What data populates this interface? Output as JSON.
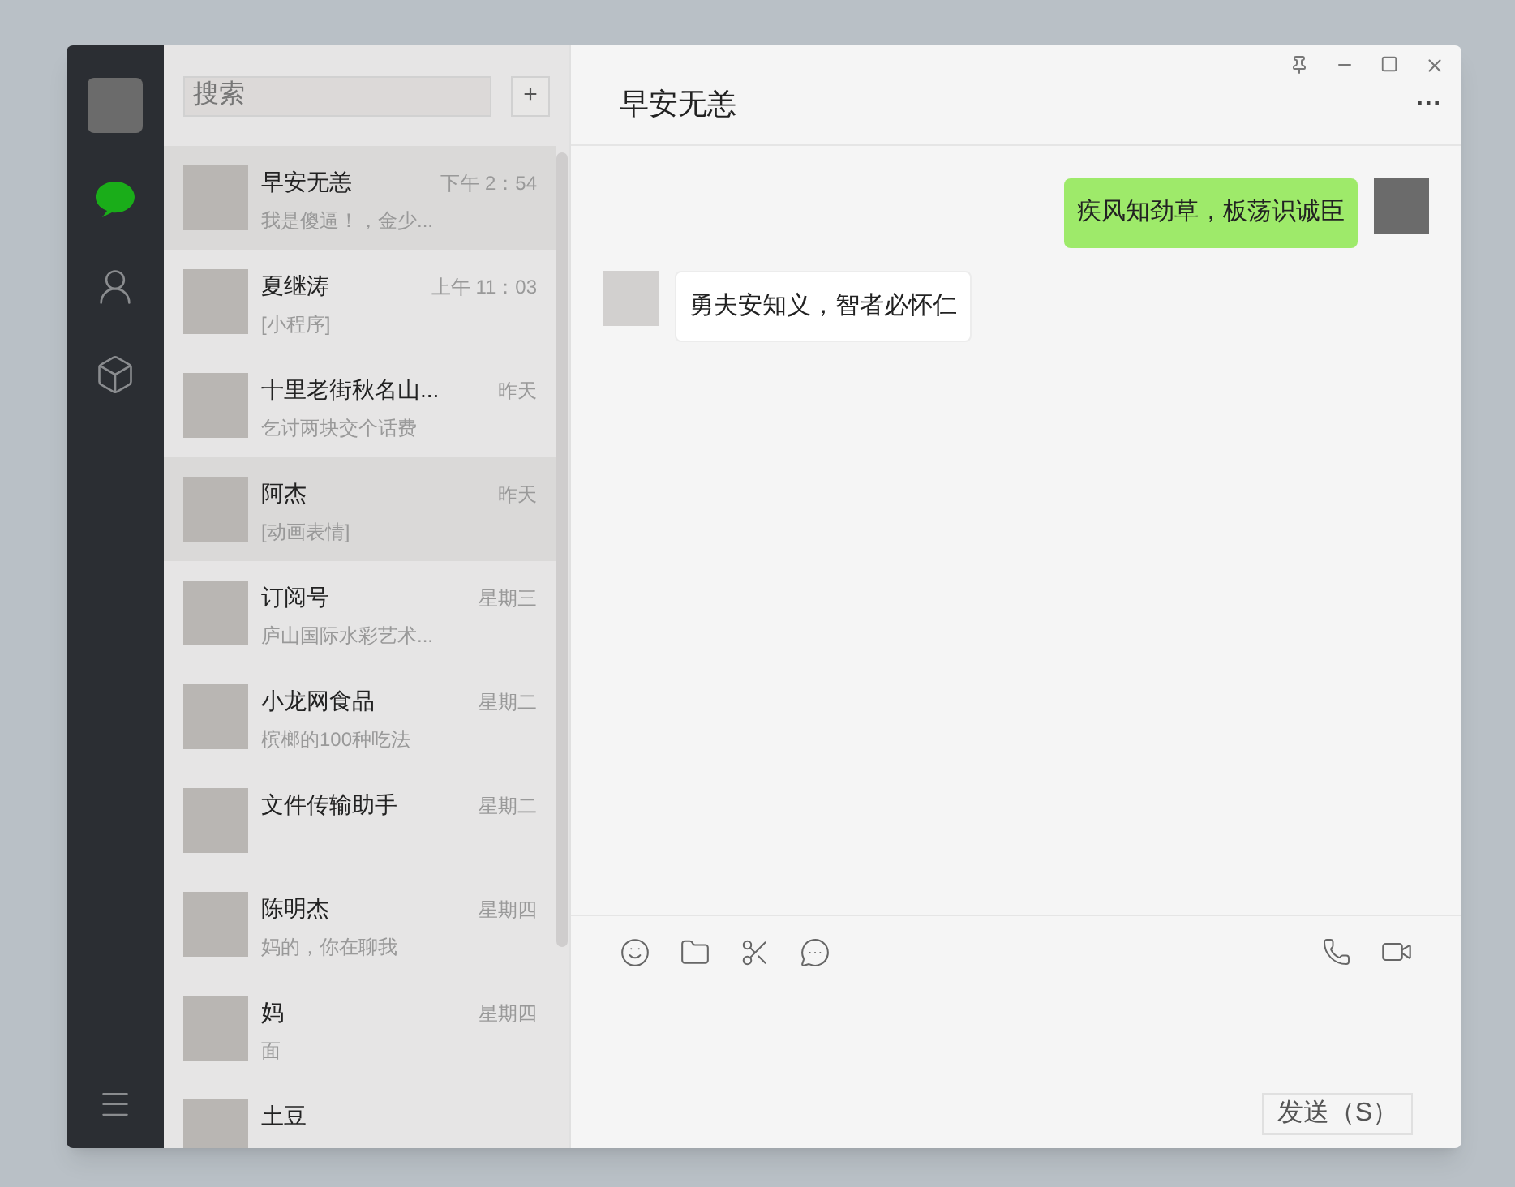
{
  "sidebar": {
    "items": [
      {
        "kind": "chat",
        "selected": true
      },
      {
        "kind": "contacts",
        "selected": false
      },
      {
        "kind": "box",
        "selected": false
      }
    ]
  },
  "search": {
    "placeholder": "搜索",
    "add_label": "+"
  },
  "chats": [
    {
      "name": "早安无恙",
      "time": "下午 2：54",
      "preview": "我是傻逼！，金少...",
      "selected": true
    },
    {
      "name": "夏继涛",
      "time": "上午 11：03",
      "preview": "[小程序]",
      "selected": false
    },
    {
      "name": "十里老街秋名山...",
      "time": "昨天",
      "preview": "乞讨两块交个话费",
      "selected": false
    },
    {
      "name": "阿杰",
      "time": "昨天",
      "preview": "[动画表情]",
      "selected": true
    },
    {
      "name": "订阅号",
      "time": "星期三",
      "preview": "庐山国际水彩艺术...",
      "selected": false
    },
    {
      "name": "小龙网食品",
      "time": "星期二",
      "preview": "槟榔的100种吃法",
      "selected": false
    },
    {
      "name": "文件传输助手",
      "time": "星期二",
      "selected": false
    },
    {
      "name": "陈明杰",
      "time": "星期四",
      "preview": "妈的，你在聊我",
      "selected": false
    },
    {
      "name": "妈",
      "time": "星期四",
      "preview": "面",
      "selected": false
    },
    {
      "name": "土豆",
      "selected": false
    }
  ],
  "chat": {
    "title": "早安无恙",
    "more": "···",
    "messages": [
      {
        "kind": "sent",
        "text": "疾风知劲草，板荡识诚臣"
      },
      {
        "kind": "received",
        "text": "勇夫安知义，智者必怀仁"
      }
    ],
    "send_button": "发送（S）"
  }
}
